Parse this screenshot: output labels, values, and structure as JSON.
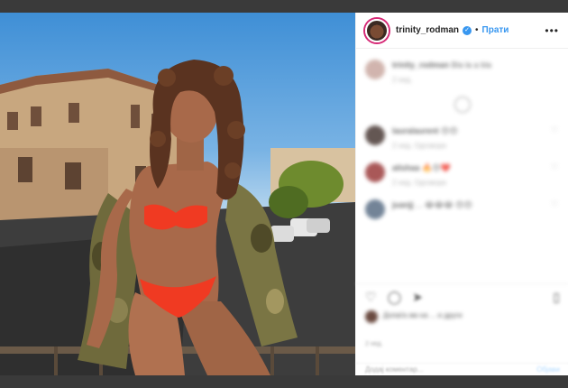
{
  "post": {
    "username": "trinity_rodman",
    "follow_label": "Прати",
    "dot": "•",
    "more_label": "•••"
  },
  "comments": [
    {
      "user": "trinity_rodman",
      "text": "Bla la a bla",
      "meta": "2 нед."
    },
    {
      "user": "lauralaurent",
      "text": "",
      "meta": "2 нед.   Одговори"
    },
    {
      "user": "alishaa",
      "text": "",
      "meta": "2 нед.   Одговори"
    },
    {
      "user": "juanjj",
      "text": "...",
      "meta": ""
    }
  ],
  "likes": {
    "text": "Допаѓа им на ... и други"
  },
  "date": "2 нед.",
  "add_comment": {
    "placeholder": "Додај коментар...",
    "post_label": "Објави"
  },
  "icons": [
    "heart-icon",
    "comment-icon",
    "share-icon",
    "bookmark-icon",
    "more-icon",
    "verified-icon"
  ],
  "colors": {
    "link": "#3897f0",
    "story_ring": "#d62976",
    "bikini": "#f03a22",
    "sky": "#3f8fd6"
  }
}
